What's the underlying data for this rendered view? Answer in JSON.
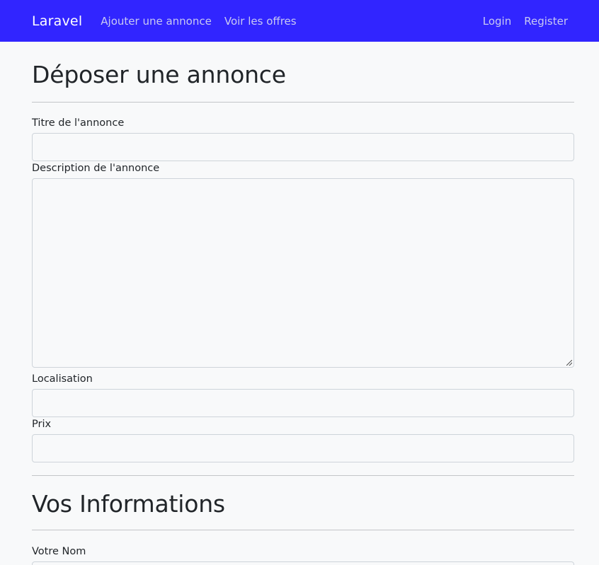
{
  "navbar": {
    "brand": "Laravel",
    "links": [
      {
        "label": "Ajouter une annonce"
      },
      {
        "label": "Voir les offres"
      }
    ],
    "auth": [
      {
        "label": "Login"
      },
      {
        "label": "Register"
      }
    ],
    "background_color": "#3125ff"
  },
  "form": {
    "title": "Déposer une annonce",
    "fields": {
      "titre": {
        "label": "Titre de l'annonce",
        "value": "",
        "placeholder": ""
      },
      "description": {
        "label": "Description de l'annonce",
        "value": "",
        "placeholder": ""
      },
      "localisation": {
        "label": "Localisation",
        "value": "",
        "placeholder": ""
      },
      "prix": {
        "label": "Prix",
        "value": "",
        "placeholder": ""
      }
    }
  },
  "informations": {
    "title": "Vos Informations",
    "fields": {
      "nom": {
        "label": "Votre Nom",
        "value": "",
        "placeholder": ""
      }
    }
  }
}
